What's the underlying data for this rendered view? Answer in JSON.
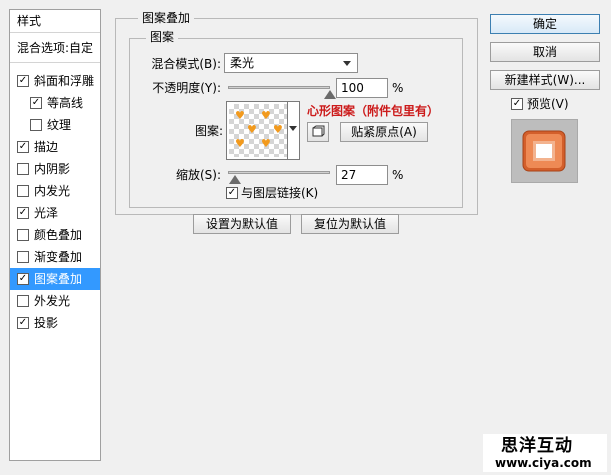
{
  "sidebar": {
    "header": "样式",
    "blend_options": "混合选项:自定",
    "items": [
      {
        "label": "斜面和浮雕",
        "checked": true,
        "selected": false,
        "indent": false
      },
      {
        "label": "等高线",
        "checked": true,
        "selected": false,
        "indent": true
      },
      {
        "label": "纹理",
        "checked": false,
        "selected": false,
        "indent": true
      },
      {
        "label": "描边",
        "checked": true,
        "selected": false,
        "indent": false
      },
      {
        "label": "内阴影",
        "checked": false,
        "selected": false,
        "indent": false
      },
      {
        "label": "内发光",
        "checked": false,
        "selected": false,
        "indent": false
      },
      {
        "label": "光泽",
        "checked": true,
        "selected": false,
        "indent": false
      },
      {
        "label": "颜色叠加",
        "checked": false,
        "selected": false,
        "indent": false
      },
      {
        "label": "渐变叠加",
        "checked": false,
        "selected": false,
        "indent": false
      },
      {
        "label": "图案叠加",
        "checked": true,
        "selected": true,
        "indent": false
      },
      {
        "label": "外发光",
        "checked": false,
        "selected": false,
        "indent": false
      },
      {
        "label": "投影",
        "checked": true,
        "selected": false,
        "indent": false
      }
    ]
  },
  "panel": {
    "outer_title": "图案叠加",
    "inner_title": "图案",
    "blend_mode_label": "混合模式(B):",
    "blend_mode_value": "柔光",
    "opacity_label": "不透明度(Y):",
    "opacity_value": "100",
    "opacity_unit": "%",
    "opacity_fraction": 1.0,
    "pattern_label": "图案:",
    "pattern_note": "心形图案（附件包里有）",
    "snap_origin_button": "贴紧原点(A)",
    "scale_label": "缩放(S):",
    "scale_value": "27",
    "scale_unit": "%",
    "scale_fraction": 0.27,
    "link_layer_label": "与图层链接(K)",
    "link_layer_checked": true,
    "set_default_button": "设置为默认值",
    "reset_default_button": "复位为默认值"
  },
  "actions": {
    "ok": "确定",
    "cancel": "取消",
    "new_style": "新建样式(W)...",
    "preview_label": "预览(V)",
    "preview_checked": true
  },
  "watermark": {
    "line1": "思洋互动",
    "line2": "www.ciya.com"
  },
  "icons": {
    "dropdown": "chevron-down-icon",
    "check": "checkmark-icon",
    "new_preset": "new-preset-icon",
    "heart": "heart-icon"
  },
  "colors": {
    "selection": "#3399ff",
    "note": "#cc1b1b",
    "pattern_heart": "#f29a1d",
    "preview_orange": "#e3703b"
  }
}
